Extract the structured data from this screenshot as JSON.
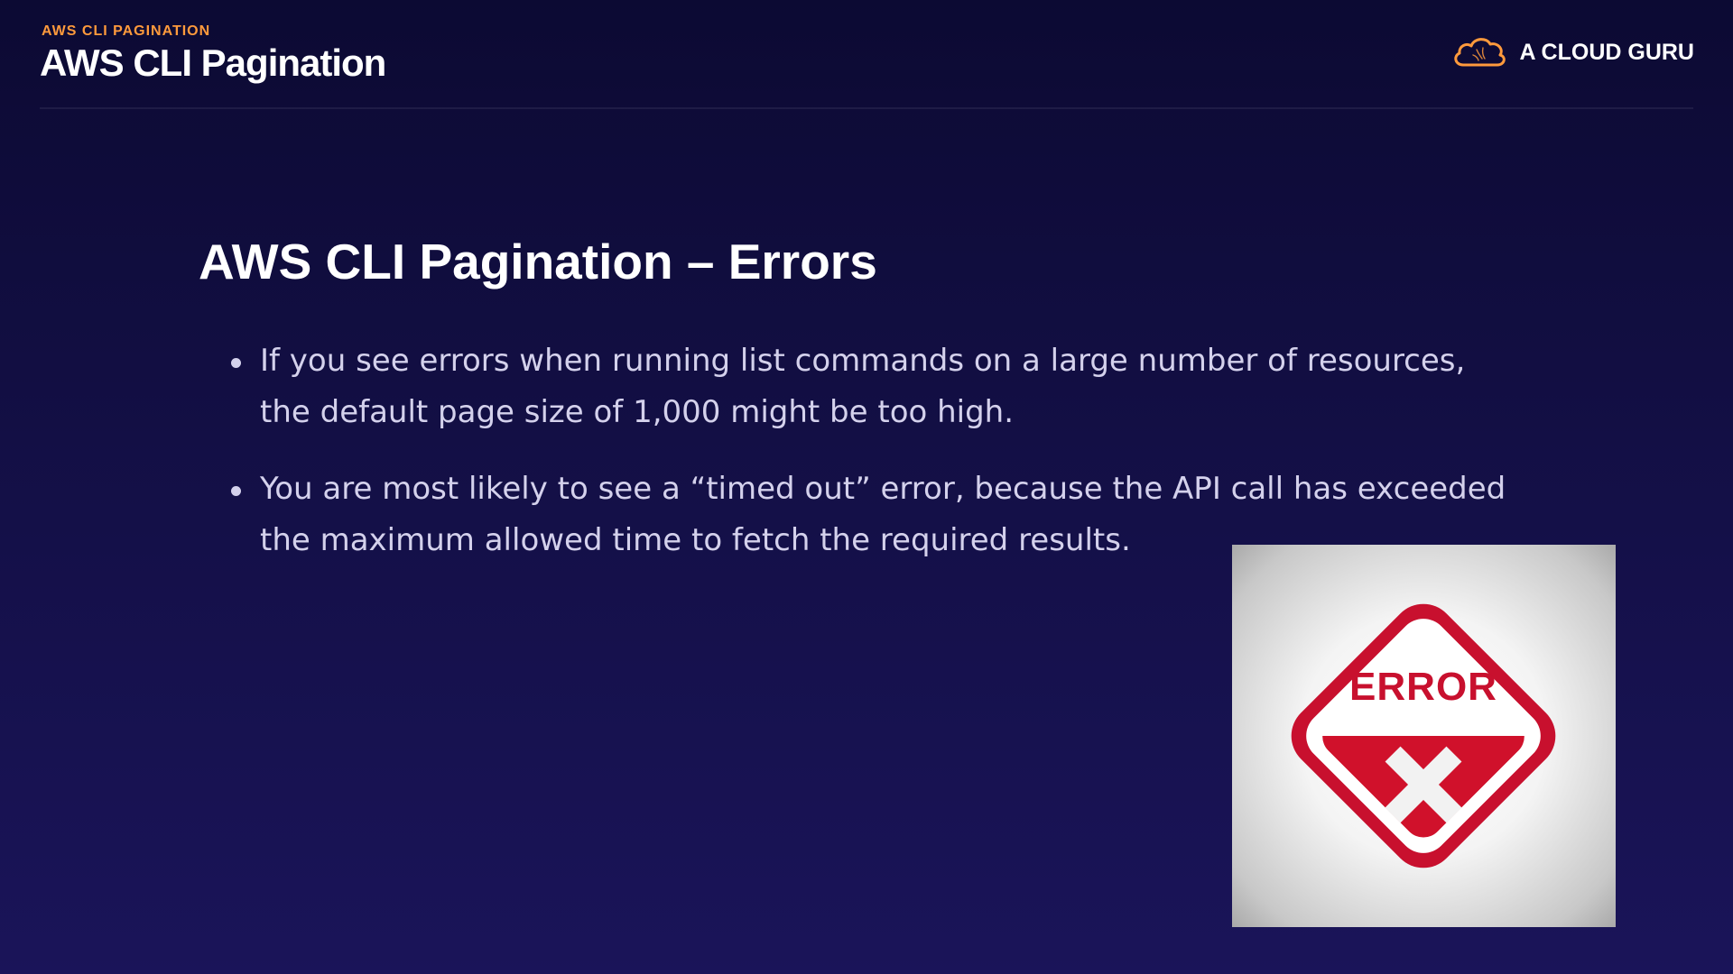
{
  "header": {
    "kicker": "AWS CLI PAGINATION",
    "title": "AWS CLI Pagination"
  },
  "brand": {
    "name": "A CLOUD GURU",
    "icon": "cloud-logo-icon",
    "accent_color": "#ff9a3c"
  },
  "slide": {
    "heading": "AWS CLI Pagination – Errors",
    "bullets": [
      "If you see errors when running list commands on a large number of resources, the default page size of 1,000 might be too high.",
      "You are most likely to see a “timed out” error, because the API call has exceeded the maximum allowed time to fetch the required results."
    ]
  },
  "error_graphic": {
    "label": "ERROR",
    "icon": "error-sign-icon",
    "color": "#c8102e"
  }
}
